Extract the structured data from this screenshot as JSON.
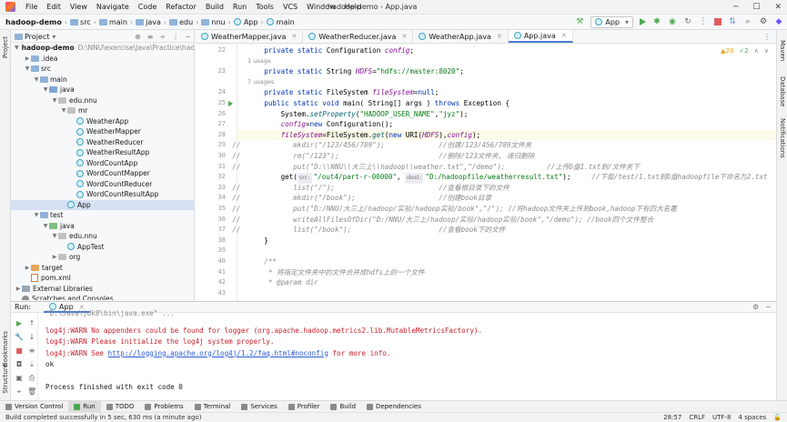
{
  "menu": {
    "items": [
      "File",
      "Edit",
      "View",
      "Navigate",
      "Code",
      "Refactor",
      "Build",
      "Run",
      "Tools",
      "VCS",
      "Window",
      "Help"
    ],
    "title": "hadoop-demo - App.java"
  },
  "navbar": {
    "crumbs": [
      "hadoop-demo",
      "src",
      "main",
      "java",
      "edu",
      "nnu",
      "App",
      "main"
    ],
    "run_config": "App"
  },
  "project_panel": {
    "title": "Project",
    "tree": [
      {
        "label": "hadoop-demo",
        "extra": "D:\\NNU\\exercise\\Java\\Practice\\hadoo",
        "depth": 0,
        "open": true,
        "icon": "module"
      },
      {
        "label": ".idea",
        "depth": 1,
        "open": false,
        "icon": "folder"
      },
      {
        "label": "src",
        "depth": 1,
        "open": true,
        "icon": "folder"
      },
      {
        "label": "main",
        "depth": 2,
        "open": true,
        "icon": "folder"
      },
      {
        "label": "java",
        "depth": 3,
        "open": true,
        "icon": "source"
      },
      {
        "label": "edu.nnu",
        "depth": 4,
        "open": true,
        "icon": "package"
      },
      {
        "label": "mr",
        "depth": 5,
        "open": true,
        "icon": "package"
      },
      {
        "label": "WeatherApp",
        "depth": 6,
        "icon": "class"
      },
      {
        "label": "WeatherMapper",
        "depth": 6,
        "icon": "class"
      },
      {
        "label": "WeatherReducer",
        "depth": 6,
        "icon": "class"
      },
      {
        "label": "WeatherResultApp",
        "depth": 6,
        "icon": "class"
      },
      {
        "label": "WordCountApp",
        "depth": 6,
        "icon": "class"
      },
      {
        "label": "WordCountMapper",
        "depth": 6,
        "icon": "class"
      },
      {
        "label": "WordCountReducer",
        "depth": 6,
        "icon": "class"
      },
      {
        "label": "WordCountResultApp",
        "depth": 6,
        "icon": "class"
      },
      {
        "label": "App",
        "depth": 5,
        "icon": "class",
        "selected": true
      },
      {
        "label": "test",
        "depth": 2,
        "open": true,
        "icon": "folder"
      },
      {
        "label": "java",
        "depth": 3,
        "open": true,
        "icon": "test"
      },
      {
        "label": "edu.nnu",
        "depth": 4,
        "open": true,
        "icon": "package"
      },
      {
        "label": "AppTest",
        "depth": 5,
        "icon": "class"
      },
      {
        "label": "org",
        "depth": 4,
        "open": false,
        "icon": "package"
      },
      {
        "label": "target",
        "depth": 1,
        "open": false,
        "icon": "target"
      },
      {
        "label": "pom.xml",
        "depth": 1,
        "icon": "xml"
      },
      {
        "label": "External Libraries",
        "depth": 0,
        "open": false,
        "icon": "lib"
      },
      {
        "label": "Scratches and Consoles",
        "depth": 0,
        "icon": "scratch"
      }
    ]
  },
  "tabs": [
    {
      "label": "WeatherMapper.java",
      "active": false
    },
    {
      "label": "WeatherReducer.java",
      "active": false
    },
    {
      "label": "WeatherApp.java",
      "active": false
    },
    {
      "label": "App.java",
      "active": true
    }
  ],
  "editor": {
    "warnings": "▲20",
    "warnings2": "✓2",
    "lines": [
      {
        "n": "22",
        "kind": "code",
        "html_key": "l22"
      },
      {
        "n": "",
        "kind": "hint",
        "text": "1 usage"
      },
      {
        "n": "23",
        "kind": "code",
        "html_key": "l23"
      },
      {
        "n": "",
        "kind": "hint",
        "text": "7 usages"
      },
      {
        "n": "24",
        "kind": "code",
        "html_key": "l24"
      },
      {
        "n": "25",
        "kind": "code",
        "html_key": "l25"
      },
      {
        "n": "26",
        "kind": "code",
        "html_key": "l26"
      },
      {
        "n": "27",
        "kind": "code",
        "html_key": "l27"
      },
      {
        "n": "28",
        "kind": "code",
        "html_key": "l28"
      },
      {
        "n": "29",
        "kind": "code",
        "html_key": "l29"
      },
      {
        "n": "30",
        "kind": "code",
        "html_key": "l30"
      },
      {
        "n": "31",
        "kind": "code",
        "html_key": "l31"
      },
      {
        "n": "32",
        "kind": "code",
        "html_key": "l32"
      },
      {
        "n": "33",
        "kind": "code",
        "html_key": "l33"
      },
      {
        "n": "34",
        "kind": "code",
        "html_key": "l34"
      },
      {
        "n": "35",
        "kind": "code",
        "html_key": "l35"
      },
      {
        "n": "36",
        "kind": "code",
        "html_key": "l36"
      },
      {
        "n": "37",
        "kind": "code",
        "html_key": "l37"
      },
      {
        "n": "38",
        "kind": "code",
        "html_key": "l38"
      },
      {
        "n": "39",
        "kind": "code",
        "html_key": "l39"
      },
      {
        "n": "40",
        "kind": "code",
        "html_key": "l40"
      },
      {
        "n": "41",
        "kind": "code",
        "html_key": "l41"
      },
      {
        "n": "42",
        "kind": "code",
        "html_key": "l42"
      },
      {
        "n": "43",
        "kind": "code",
        "html_key": "l43"
      }
    ],
    "code": {
      "l22": [
        [
          "kw",
          "    private static "
        ],
        [
          "dm",
          "Configuration "
        ],
        [
          "fld",
          "config"
        ],
        [
          "dm",
          ";"
        ]
      ],
      "l23": [
        [
          "kw",
          "    private static "
        ],
        [
          "dm",
          "String "
        ],
        [
          "fld",
          "HDFS"
        ],
        [
          "dm",
          "="
        ],
        [
          "str",
          "\"hdfs://master:8020\""
        ],
        [
          "dm",
          ";"
        ]
      ],
      "l24": [
        [
          "kw",
          "    private static "
        ],
        [
          "dm",
          "FileSystem "
        ],
        [
          "fld",
          "fileSystem"
        ],
        [
          "dm",
          "="
        ],
        [
          "kw",
          "null"
        ],
        [
          "dm",
          ";"
        ]
      ],
      "l25": [
        [
          "kw",
          "    public static void "
        ],
        [
          "dm",
          "main( String[] args ) "
        ],
        [
          "kw",
          "throws "
        ],
        [
          "dm",
          "Exception {"
        ]
      ],
      "l26": [
        [
          "dm",
          "        System."
        ],
        [
          "fn",
          "setProperty"
        ],
        [
          "dm",
          "("
        ],
        [
          "str",
          "\"HADOOP_USER_NAME\""
        ],
        [
          "dm",
          ","
        ],
        [
          "str",
          "\"jyz\""
        ],
        [
          "dm",
          ");"
        ]
      ],
      "l27": [
        [
          "fld",
          "        config"
        ],
        [
          "dm",
          "="
        ],
        [
          "kw",
          "new "
        ],
        [
          "dm",
          "Configuration();"
        ]
      ],
      "l28": [
        [
          "fld",
          "        fileSystem"
        ],
        [
          "dm",
          "=FileSystem."
        ],
        [
          "fn",
          "get"
        ],
        [
          "dm",
          "("
        ],
        [
          "kw",
          "new "
        ],
        [
          "dm",
          "URI("
        ],
        [
          "fld",
          "HDFS"
        ],
        [
          "dm",
          "),"
        ],
        [
          "fld",
          "config"
        ],
        [
          "dm",
          ");"
        ]
      ],
      "l29": [
        [
          "cm",
          "           mkdir(\"/123/456/789\");             //创建/123/456/789文件夹"
        ]
      ],
      "l30": [
        [
          "cm",
          "           rm(\"/123\");                        //删除/123文件夹, 递归删除"
        ]
      ],
      "l31": [
        [
          "cm",
          "           put(\"D:\\\\NNU\\\\大三上\\\\hadoop\\\\weather.txt\",\"/demo\");          //上传D盘1.txt到/文件夹下"
        ]
      ],
      "l32": [
        [
          "dm",
          "        get("
        ],
        [
          "badge",
          "src:"
        ],
        [
          "str",
          "\"/out4/part-r-00000\""
        ],
        [
          "dm",
          ", "
        ],
        [
          "badge",
          "dest:"
        ],
        [
          "str",
          "\"D:/hadoopfile/weatherresult.txt\""
        ],
        [
          "dm",
          ");     "
        ],
        [
          "cm",
          "//下载/test/1.txt到D盘hadoopfile下命名为2.txt"
        ]
      ],
      "l33": [
        [
          "cm",
          "           list(\"/\");                         //查看根目录下的文件"
        ]
      ],
      "l34": [
        [
          "cm",
          "           mkdir(\"/book\");                    //创建book目录"
        ]
      ],
      "l35": [
        [
          "cm",
          "           put(\"D:/NNU/大三上/hadoop/实验/hadoop实验/book\",\"/\"); //将hadoop文件夹上传到book,hadoop下有四大名著"
        ]
      ],
      "l36": [
        [
          "cm",
          "           writeAllFilesOfDir(\"D:/NNU/大三上/hadoop/实验/hadoop实验/book\",\"/demo\"); //book四个文件整合"
        ]
      ],
      "l37": [
        [
          "cm",
          "           list(\"/book\");                     //查看book下的文件"
        ]
      ],
      "l38": [
        [
          "dm",
          "    }"
        ]
      ],
      "l39": [
        [
          "dm",
          ""
        ]
      ],
      "l40": [
        [
          "cm",
          "    /**"
        ]
      ],
      "l41": [
        [
          "cm",
          "     * 将指定文件夹中的文件合并成hdfs上的一个文件"
        ]
      ],
      "l42": [
        [
          "cm",
          "     * @param dir"
        ]
      ],
      "l43": [
        [
          "dm",
          ""
        ]
      ]
    }
  },
  "run_panel": {
    "label": "Run:",
    "tab": "App",
    "console": [
      {
        "kind": "plain",
        "text": "\"D:\\Java\\jdk8\\bin\\java.exe\" ..."
      },
      {
        "kind": "err",
        "text": "log4j:WARN No appenders could be found for logger (org.apache.hadoop.metrics2.lib.MutableMetricsFactory)."
      },
      {
        "kind": "err",
        "text": "log4j:WARN Please initialize the log4j system properly."
      },
      {
        "kind": "err_link",
        "pre": "log4j:WARN See ",
        "link": "http://logging.apache.org/log4j/1.2/faq.html#noconfig",
        "post": " for more info."
      },
      {
        "kind": "plain",
        "text": "ok"
      },
      {
        "kind": "plain",
        "text": ""
      },
      {
        "kind": "plain",
        "text": "Process finished with exit code 0"
      }
    ]
  },
  "bottom_tools": [
    "Version Control",
    "Run",
    "TODO",
    "Problems",
    "Terminal",
    "Services",
    "Profiler",
    "Build",
    "Dependencies"
  ],
  "status": {
    "message": "Build completed successfully in 5 sec, 630 ms (a minute ago)",
    "position": "28:57",
    "line_sep": "CRLF",
    "encoding": "UTF-8",
    "indent": "4 spaces"
  },
  "stripes": {
    "left": [
      "Project",
      "Bookmarks",
      "Structure"
    ],
    "right": [
      "Maven",
      "Database",
      "Notifications"
    ]
  }
}
